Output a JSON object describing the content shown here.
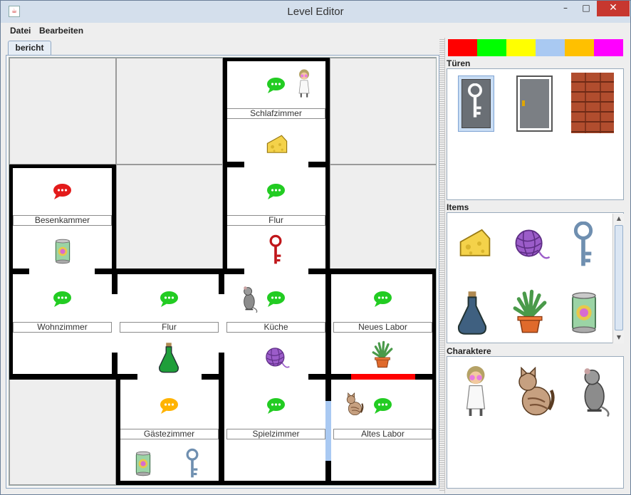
{
  "window": {
    "title": "Level Editor",
    "icon": "java-icon",
    "min_glyph": "–",
    "max_glyph": "□",
    "close_glyph": "✕"
  },
  "menu": {
    "items": [
      "Datei",
      "Bearbeiten"
    ]
  },
  "tab": {
    "label": "bericht"
  },
  "rooms": {
    "schlafzimmer": "Schlafzimmer",
    "besenkammer": "Besenkammer",
    "flur_top": "Flur",
    "wohnzimmer": "Wohnzimmer",
    "flur_mid": "Flur",
    "kueche": "Küche",
    "neues_labor": "Neues Labor",
    "gaestezimmer": "Gästezimmer",
    "spielzimmer": "Spielzimmer",
    "altes_labor": "Altes Labor"
  },
  "door_colors": [
    "#ff0000",
    "#00ff00",
    "#ffff00",
    "#a9c9f2",
    "#ffc000",
    "#ff00ff"
  ],
  "sidebar": {
    "doors_title": "Türen",
    "items_title": "Items",
    "characters_title": "Charaktere",
    "doors": [
      "key-door-icon",
      "plain-door-icon",
      "brick-wall-icon"
    ],
    "items": [
      "cheese-icon",
      "yarn-ball-icon",
      "key-icon",
      "potion-bottle-icon",
      "plant-icon",
      "can-icon"
    ],
    "characters": [
      "professor-icon",
      "cat-icon",
      "rat-icon"
    ]
  },
  "icons": {
    "speech_bubble": "speech-bubble-icon"
  },
  "colors": {
    "bubble_green": "#22cc22",
    "bubble_red": "#e31b1b",
    "bubble_orange": "#ffb300"
  }
}
